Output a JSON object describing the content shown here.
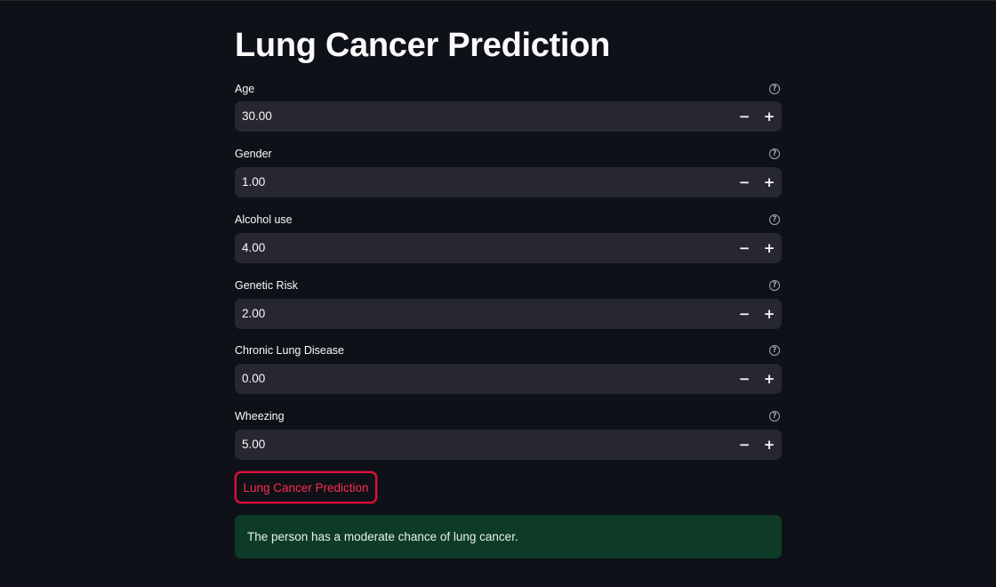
{
  "page": {
    "title": "Lung Cancer Prediction"
  },
  "fields": [
    {
      "label": "Age",
      "value": "30.00"
    },
    {
      "label": "Gender",
      "value": "1.00"
    },
    {
      "label": "Alcohol use",
      "value": "4.00"
    },
    {
      "label": "Genetic Risk",
      "value": "2.00"
    },
    {
      "label": "Chronic Lung Disease",
      "value": "0.00"
    },
    {
      "label": "Wheezing",
      "value": "5.00"
    }
  ],
  "controls": {
    "help_glyph": "?",
    "minus_glyph": "−",
    "plus_glyph": "+"
  },
  "button": {
    "label": "Lung Cancer Prediction"
  },
  "result": {
    "message": "The person has a moderate chance of lung cancer."
  },
  "icons": [
    "help-icon",
    "minus-icon",
    "plus-icon"
  ],
  "colors": {
    "background": "#0e1117",
    "input_background": "#262730",
    "button_border": "#e0103b",
    "button_text": "#ff2b4f",
    "success_background": "#0e3b27"
  }
}
